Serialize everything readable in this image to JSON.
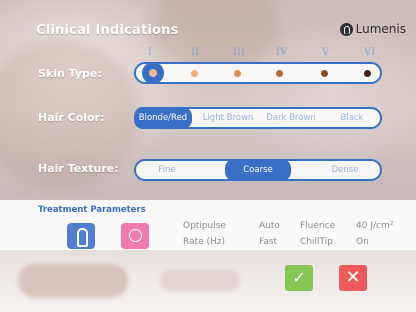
{
  "header": {
    "title": "Clinical Indications",
    "brand": "Lumenis"
  },
  "skin_type": {
    "label": "Skin Type:",
    "numerals": [
      "I",
      "II",
      "III",
      "IV",
      "V",
      "VI"
    ],
    "selected_index": 0,
    "dot_colors": [
      "#f5b988",
      "#f1ac78",
      "#e08d50",
      "#b9663a",
      "#8b4a2a",
      "#3f2216"
    ]
  },
  "hair_color": {
    "label": "Hair Color:",
    "options": [
      "Blonde/Red",
      "Light Brown",
      "Dark Brown",
      "Black"
    ],
    "selected_index": 0
  },
  "hair_texture": {
    "label": "Hair Texture:",
    "options": [
      "Fine",
      "Coarse",
      "Dense"
    ],
    "selected_index": 1
  },
  "treatment": {
    "title": "Treatment Parameters",
    "rows": [
      [
        "Optipulse",
        "Auto",
        "Fluence",
        "40 J/cm²"
      ],
      [
        "Rate (Hz)",
        "Fast",
        "ChillTip",
        "On"
      ]
    ]
  },
  "actions": {
    "confirm_symbol": "✓",
    "cancel_symbol": "✕"
  },
  "colors": {
    "accent_blue": "#3a6fc8",
    "confirm_green": "#87c653",
    "cancel_red": "#ee5a5a",
    "pink_applicator": "#f279ad"
  }
}
